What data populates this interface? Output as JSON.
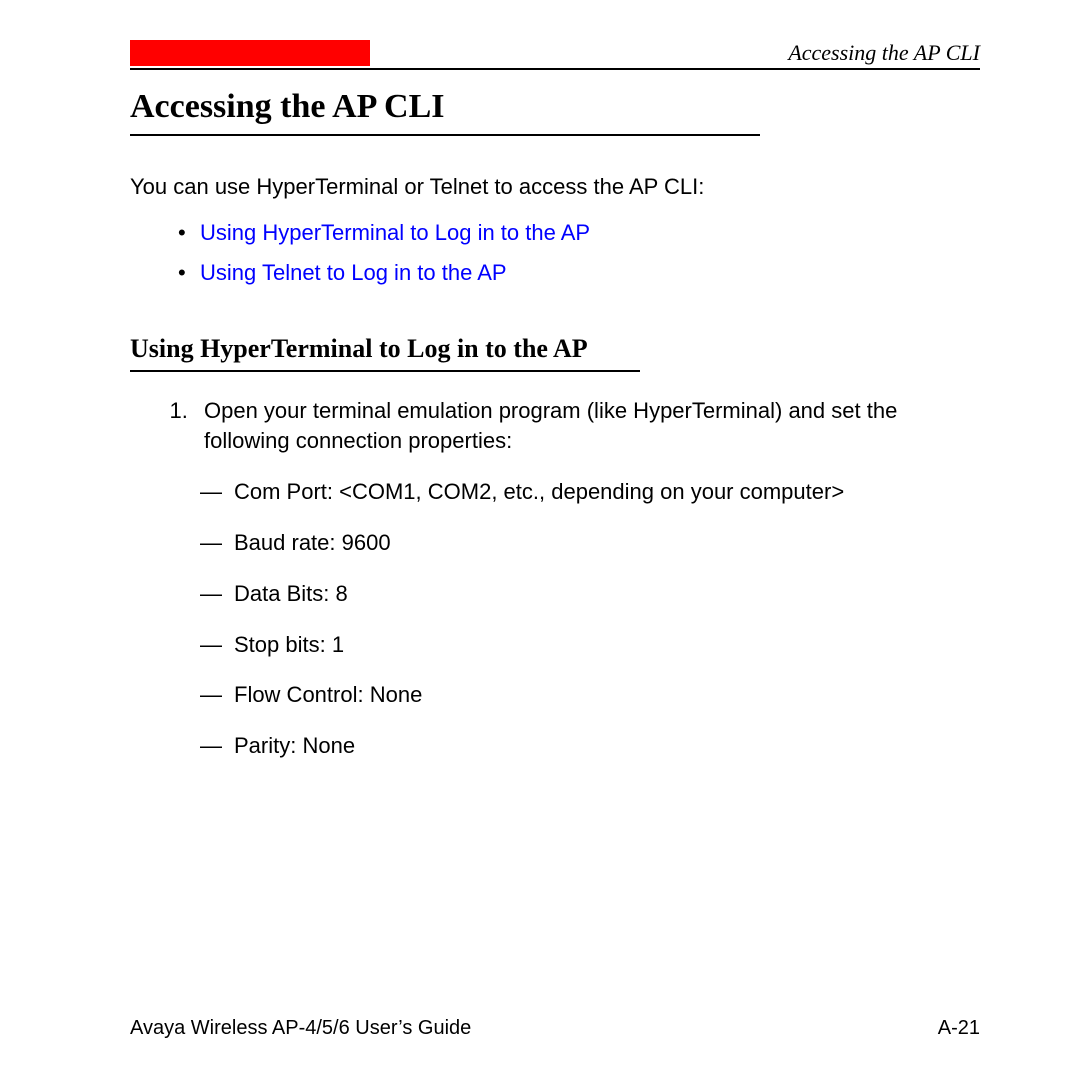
{
  "header": {
    "running_title": "Accessing the AP CLI"
  },
  "title": "Accessing the AP CLI",
  "intro": "You can use HyperTerminal or Telnet to access the AP CLI:",
  "links": [
    "Using HyperTerminal to Log in to the AP",
    "Using Telnet to Log in to the AP"
  ],
  "subheading": "Using HyperTerminal to Log in to the AP",
  "step1": "Open your terminal emulation program (like HyperTerminal) and set the following connection properties:",
  "settings": [
    "Com Port: <COM1, COM2, etc., depending on your computer>",
    "Baud rate: 9600",
    "Data Bits: 8",
    "Stop bits: 1",
    "Flow Control: None",
    "Parity: None"
  ],
  "footer": {
    "guide": "Avaya Wireless AP-4/5/6 User’s Guide",
    "page": "A-21"
  }
}
